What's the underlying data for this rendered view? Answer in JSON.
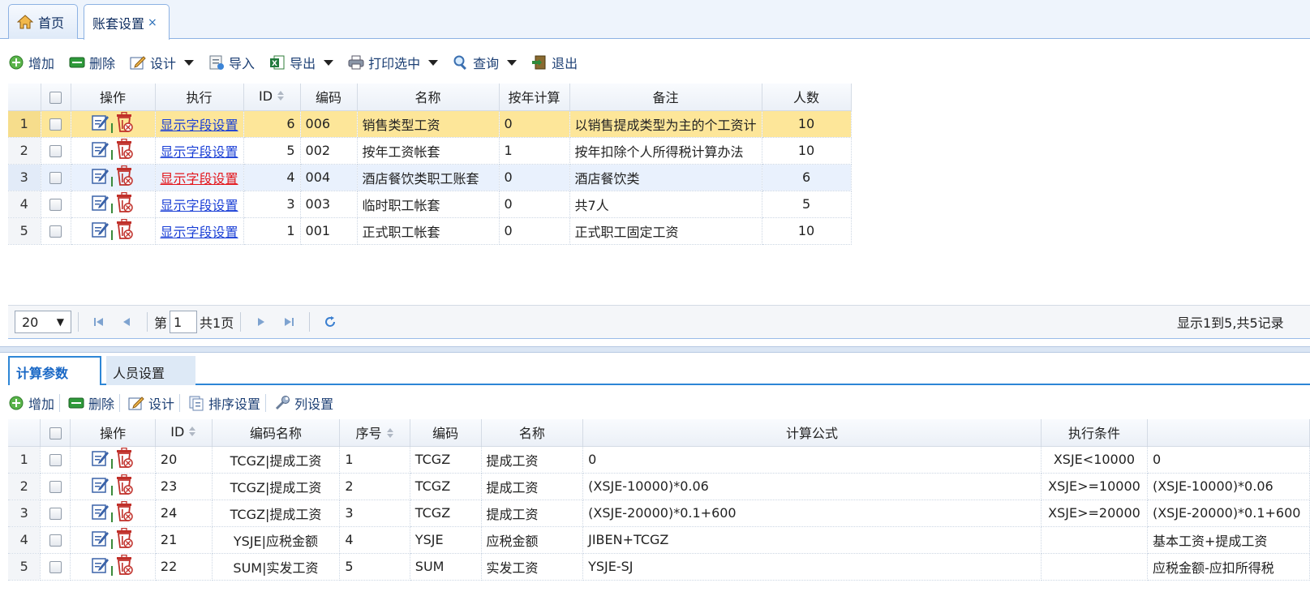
{
  "tabs": [
    {
      "label": "首页"
    },
    {
      "label": "账套设置",
      "close": "×"
    }
  ],
  "toolbar": {
    "add": "增加",
    "delete": "删除",
    "design": "设计",
    "import": "导入",
    "export": "导出",
    "print": "打印选中",
    "query": "查询",
    "exit": "退出"
  },
  "grid": {
    "headers": [
      "操作",
      "执行",
      "ID",
      "编码",
      "名称",
      "按年计算",
      "备注",
      "人数"
    ],
    "rows": [
      {
        "n": "1",
        "exec": "显示字段设置",
        "id": "6",
        "code": "006",
        "name": "销售类型工资",
        "yearly": "0",
        "note": "以销售提成类型为主的个工资计",
        "count": "10"
      },
      {
        "n": "2",
        "exec": "显示字段设置",
        "id": "5",
        "code": "002",
        "name": "按年工资帐套",
        "yearly": "1",
        "note": "按年扣除个人所得税计算办法",
        "count": "10"
      },
      {
        "n": "3",
        "exec": "显示字段设置",
        "id": "4",
        "code": "004",
        "name": "酒店餐饮类职工账套",
        "yearly": "0",
        "note": "酒店餐饮类",
        "count": "6"
      },
      {
        "n": "4",
        "exec": "显示字段设置",
        "id": "3",
        "code": "003",
        "name": "临时职工帐套",
        "yearly": "0",
        "note": "共7人",
        "count": "5"
      },
      {
        "n": "5",
        "exec": "显示字段设置",
        "id": "1",
        "code": "001",
        "name": "正式职工帐套",
        "yearly": "0",
        "note": "正式职工固定工资",
        "count": "10"
      }
    ]
  },
  "pager": {
    "page_size": "20",
    "page_label": "第",
    "page_value": "1",
    "total_pages": "共1页",
    "info": "显示1到5,共5记录"
  },
  "subtabs": [
    "计算参数",
    "人员设置"
  ],
  "toolbar2": {
    "add": "增加",
    "delete": "删除",
    "design": "设计",
    "sort": "排序设置",
    "columns": "列设置"
  },
  "grid2": {
    "headers": [
      "操作",
      "ID",
      "编码名称",
      "序号",
      "编码",
      "名称",
      "计算公式",
      "执行条件",
      ""
    ],
    "rows": [
      {
        "n": "1",
        "id": "20",
        "codename": "TCGZ|提成工资",
        "seq": "1",
        "code": "TCGZ",
        "name": "提成工资",
        "formula": "0",
        "cond": "XSJE<10000",
        "extra": "0"
      },
      {
        "n": "2",
        "id": "23",
        "codename": "TCGZ|提成工资",
        "seq": "2",
        "code": "TCGZ",
        "name": "提成工资",
        "formula": "(XSJE-10000)*0.06",
        "cond": "XSJE>=10000",
        "extra": "(XSJE-10000)*0.06"
      },
      {
        "n": "3",
        "id": "24",
        "codename": "TCGZ|提成工资",
        "seq": "3",
        "code": "TCGZ",
        "name": "提成工资",
        "formula": "(XSJE-20000)*0.1+600",
        "cond": "XSJE>=20000",
        "extra": "(XSJE-20000)*0.1+600"
      },
      {
        "n": "4",
        "id": "21",
        "codename": "YSJE|应税金额",
        "seq": "4",
        "code": "YSJE",
        "name": "应税金额",
        "formula": "JIBEN+TCGZ",
        "cond": "",
        "extra": "基本工资+提成工资"
      },
      {
        "n": "5",
        "id": "22",
        "codename": "SUM|实发工资",
        "seq": "5",
        "code": "SUM",
        "name": "实发工资",
        "formula": "YSJE-SJ",
        "cond": "",
        "extra": "应税金额-应扣所得税"
      }
    ]
  }
}
